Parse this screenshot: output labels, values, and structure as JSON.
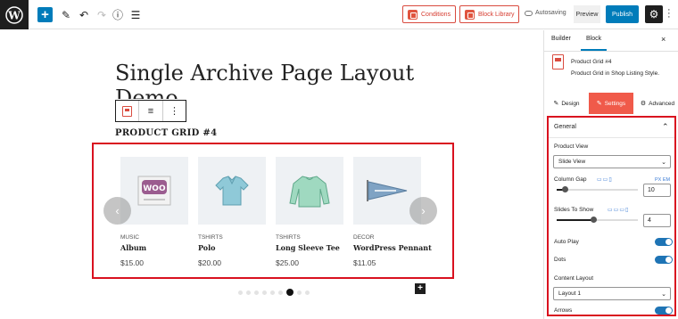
{
  "topbar": {
    "undo_icon": "undo-icon",
    "redo_icon": "redo-icon",
    "conditions_label": "Conditions",
    "block_library_label": "Block Library",
    "autosave_label": "Autosaving",
    "preview_label": "Preview",
    "publish_label": "Publish"
  },
  "page": {
    "title_line1": "Single Archive Page Layout",
    "title_line2": "Demo",
    "block_heading": "PRODUCT GRID #4"
  },
  "products": [
    {
      "category": "MUSIC",
      "name": "Album",
      "price": "$15.00"
    },
    {
      "category": "TSHIRTS",
      "name": "Polo",
      "price": "$20.00"
    },
    {
      "category": "TSHIRTS",
      "name": "Long Sleeve Tee",
      "price": "$25.00"
    },
    {
      "category": "DECOR",
      "name": "WordPress Pennant",
      "price": "$11.05"
    }
  ],
  "product_images": {
    "album_text": "WOO"
  },
  "carousel": {
    "prev": "‹",
    "next": "›",
    "dot_count": 9,
    "active_dot": 6
  },
  "sidebar": {
    "tab_builder": "Builder",
    "tab_block": "Block",
    "close": "×",
    "block_title": "Product Grid #4",
    "block_desc": "Product Grid in Shop Listing Style.",
    "subtab_design": "Design",
    "subtab_settings": "Settings",
    "subtab_advanced": "Advanced",
    "section_general": "General",
    "product_view_label": "Product View",
    "product_view_value": "Slide View",
    "column_gap_label": "Column Gap",
    "column_gap_units": "PX  EM",
    "column_gap_value": "10",
    "column_gap_level": 0.1,
    "slides_label": "Slides To Show",
    "slides_value": "4",
    "slides_level": 0.45,
    "autoplay_label": "Auto Play",
    "dots_label": "Dots",
    "content_layout_label": "Content Layout",
    "content_layout_value": "Layout 1",
    "arrows_label": "Arrows"
  },
  "colors": {
    "accent": "#007cba",
    "brand": "#f05a4a",
    "highlight": "#d9111f"
  }
}
